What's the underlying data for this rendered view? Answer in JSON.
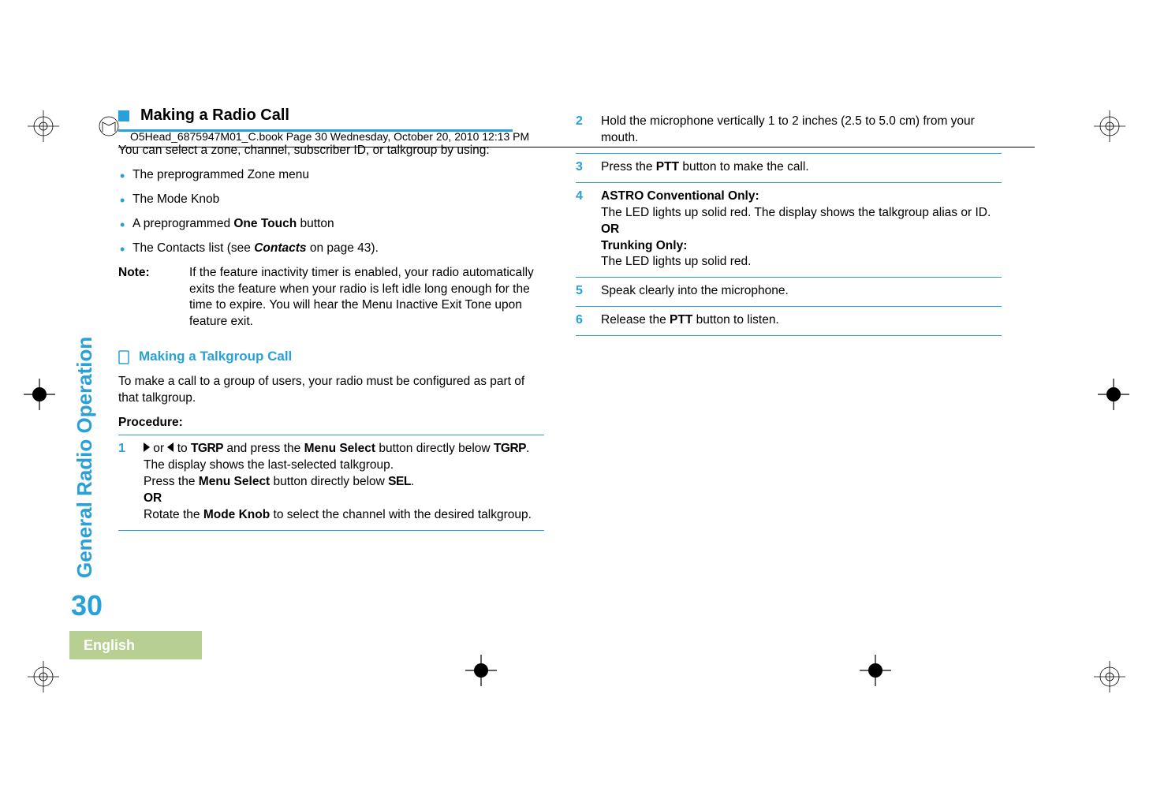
{
  "header": "O5Head_6875947M01_C.book  Page 30  Wednesday, October 20, 2010  12:13 PM",
  "sidebar": {
    "section_label": "General Radio Operation",
    "page_number": "30",
    "language": "English"
  },
  "left": {
    "heading": "Making a Radio Call",
    "intro": "You can select a zone, channel, subscriber ID, or talkgroup by using:",
    "bullets": [
      "The preprogrammed Zone menu",
      "The Mode Knob",
      {
        "pre": "A preprogrammed ",
        "bold": "One Touch",
        "post": " button"
      },
      {
        "pre": "The Contacts list (see ",
        "bi": "Contacts",
        "post": " on page 43)."
      }
    ],
    "note_label": "Note:",
    "note_body": "If the feature inactivity timer is enabled, your radio automatically exits the feature when your radio is left idle long enough for the time to expire. You will hear the Menu Inactive Exit Tone upon feature exit.",
    "sub_heading": "Making a Talkgroup Call",
    "sub_intro": "To make a call to a group of users, your radio must be configured as part of that talkgroup.",
    "procedure_label": "Procedure:",
    "step1": {
      "num": "1",
      "seg_or": " or ",
      "seg_to": " to ",
      "tgrp": "TGRP",
      "seg_press_ms": " and press the ",
      "menu_select": "Menu Select",
      "seg_btn_below": " button directly below ",
      "tgrp2": "TGRP",
      "period": ".",
      "line2": "The display shows the last-selected talkgroup.",
      "line3a": "Press the ",
      "line3b": " button directly below ",
      "sel": "SEL",
      "line3c": ".",
      "or": "OR",
      "line4a": "Rotate the ",
      "mode_knob": "Mode Knob",
      "line4b": " to select the channel with the desired talkgroup."
    }
  },
  "right": {
    "step2": {
      "num": "2",
      "text": "Hold the microphone vertically 1 to 2 inches (2.5 to 5.0 cm) from your mouth."
    },
    "step3": {
      "num": "3",
      "pre": "Press the ",
      "ptt": "PTT",
      "post": " button to make the call."
    },
    "step4": {
      "num": "4",
      "l1": "ASTRO Conventional Only:",
      "l2": "The LED lights up solid red. The display shows the talkgroup alias or ID.",
      "or": "OR",
      "l3": "Trunking Only:",
      "l4": "The LED lights up solid red."
    },
    "step5": {
      "num": "5",
      "text": "Speak clearly into the microphone."
    },
    "step6": {
      "num": "6",
      "pre": "Release the ",
      "ptt": "PTT",
      "post": " button to listen."
    }
  }
}
